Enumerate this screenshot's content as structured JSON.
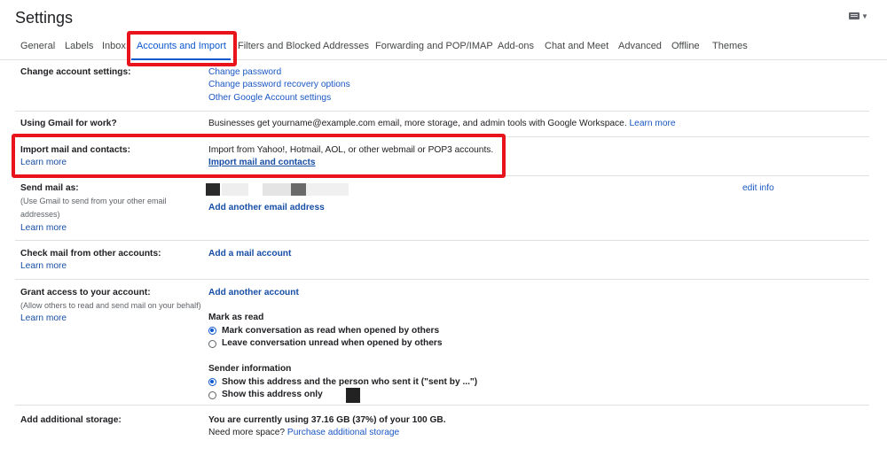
{
  "header": {
    "title": "Settings",
    "keyboard_icon": "keyboard-icon"
  },
  "tabs": [
    {
      "label": "General"
    },
    {
      "label": "Labels"
    },
    {
      "label": "Inbox"
    },
    {
      "label": "Accounts and Import",
      "active": true
    },
    {
      "label": "Filters and Blocked Addresses"
    },
    {
      "label": "Forwarding and POP/IMAP"
    },
    {
      "label": "Add-ons"
    },
    {
      "label": "Chat and Meet"
    },
    {
      "label": "Advanced"
    },
    {
      "label": "Offline"
    },
    {
      "label": "Themes"
    }
  ],
  "rows": {
    "change_account": {
      "label": "Change account settings:",
      "links": [
        "Change password",
        "Change password recovery options",
        "Other Google Account settings"
      ]
    },
    "work": {
      "label": "Using Gmail for work?",
      "text": "Businesses get yourname@example.com email, more storage, and admin tools with Google Workspace.",
      "link": "Learn more"
    },
    "import": {
      "label": "Import mail and contacts:",
      "learn_more": "Learn more",
      "text": "Import from Yahoo!, Hotmail, AOL, or other webmail or POP3 accounts.",
      "link": "Import mail and contacts"
    },
    "send_as": {
      "label": "Send mail as:",
      "sub_line1": "(Use Gmail to send from your other email",
      "sub_line2": "addresses)",
      "learn_more": "Learn more",
      "edit": "edit info",
      "add": "Add another email address"
    },
    "check_mail": {
      "label": "Check mail from other accounts:",
      "learn_more": "Learn more",
      "add": "Add a mail account"
    },
    "grant": {
      "label": "Grant access to your account:",
      "sub": "(Allow others to read and send mail on your behalf)",
      "learn_more": "Learn more",
      "add": "Add another account",
      "mark_as_read_heading": "Mark as read",
      "mark_options": [
        "Mark conversation as read when opened by others",
        "Leave conversation unread when opened by others"
      ],
      "mark_selected": 0,
      "sender_heading": "Sender information",
      "sender_options": [
        "Show this address and the person who sent it (\"sent by ...\")",
        "Show this address only"
      ],
      "sender_selected": 0
    },
    "storage": {
      "label": "Add additional storage:",
      "usage": "You are currently using 37.16 GB (37%) of your 100 GB.",
      "need_more": "Need more space?",
      "purchase": "Purchase additional storage"
    }
  },
  "colors": {
    "accent": "#0b57d0",
    "link": "#1a57c4",
    "highlight": "#e8131b"
  }
}
